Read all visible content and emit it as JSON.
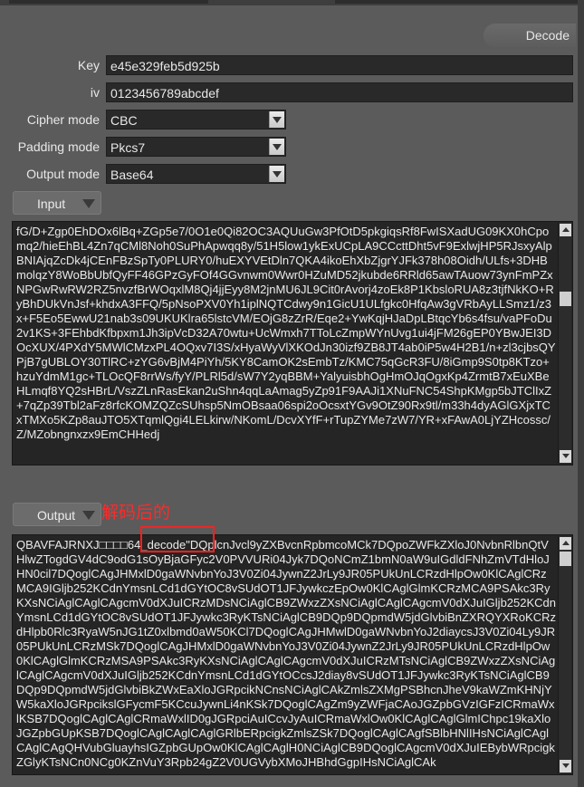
{
  "decode_button": "Decode",
  "key": {
    "label": "Key",
    "value": "e45e329feb5d925b"
  },
  "iv": {
    "label": "iv",
    "value": "0123456789abcdef"
  },
  "cipher_mode": {
    "label": "Cipher mode",
    "value": "CBC"
  },
  "padding_mode": {
    "label": "Padding mode",
    "value": "Pkcs7"
  },
  "output_mode": {
    "label": "Output mode",
    "value": "Base64"
  },
  "input_toggle": "Input",
  "input_text": "fG/D+Zgp0EhDOx6lBq+ZGp5e7/0O1e0Qi82OC3AQUuGw3PfOtD5pkgiqsRf8FwISXadUG09KX0hCpomq2/hieEhBL4Zn7qCMl8Noh0SuPhApwqq8y/51H5low1ykExUCpLA9CCcttDht5vF9ExlwjHP5RJsxyAlpBNIAjqZcDk4jCEnFBzSpTy0PLURY0/huEXYVEtDln7QKA4ikoEhXbZjgrYJFk378h08Oidh/ULfs+3DHBmolqzY8WoBbUbfQyFF46GPzGyFOf4GGvnwm0Wwr0HZuMD52jkubde6RRld65awTAuow73ynFmPZxNPGwRwRW2RZ5nvzfBrWOqxlM8Qj4jjEyy8M2jnMU6JL9Cit0rAvorj4zoEk8P1KbsloRUA8z3tjfNkKO+RyBhDUkVnJsf+khdxA3FFQ/5pNsoPXV0Yh1iplNQTCdwy9n1GicU1ULfgkc0HfqAw3gVRbAyLLSmz1/z3x+F5Eo5EwwU21nab3s09UKUKlra65lstcVM/EOjG8zZrR/Eqe2+YwKqjHJaDpLBtqcYb6s4fsu/vaPFoDu2v1KS+3FEhbdKfbpxm1Jh3ipVcD32A70wtu+UcWmxh7TToLcZmpWYnUvg1ui4jFM26gEP0YBwJEI3DOcXUX/4PXdY5MWlCMzxPL4OQxv7I3S/xHyaWyVlXKOdJn30izf9ZB8JT4ab0iP5w4H2B1/n+zl3cjbsQYPjB7gUBLOY30TlRC+zYG6vBjM4PiYh/5KY8CamOK2sEmbTz/KMC75qGcR3FU/8iGmp9S0tp8KTzo+hzuYdmM1gc+TLOcQF8rrWs/fyY/PLRl5d/sW7Y2yqBBM+YalyuisbhOgHmOJqOgxKp4ZrmtB7xEuXBeHLmqf8YQ2sHBrL/VszZLnRasEkan2uShn4qqLaAmag5yZp91F9AAJi1XNuFNC54ShpKMgp5bJTClIxZ+7qZp39Tbl2aFz8rfcKOMZQZcSUhsp5NmOBsaa06spi2oOcsxtYGv9OtZ90Rx9tl/m33h4dyAGlGXjxTCxTMXo5KZp8auJTO5XTqmlQgi4LELkirw/NKomL/DcvXYfF+rTupZYMe7zW7/YR+xFAwA0LjYZHcossc/Z/MZobngnxzx9EmCHHedj",
  "annotation_text": "解码后的",
  "output_toggle": "Output",
  "output_text": "QBAVFAJRNXJ□□□□64_decode\"DQplcnJvcl9yZXBvcnRpbmcoMCk7DQpoZWFkZXloJ0NvbnRlbnQtVHlwZTogdGV4dC9odG1sOyBjaGFyc2V0PVVURi04Jyk7DQoNCmZ1bmN0aW9uIGdldFNhZmVTdHloJHN0cil7DQoglCAgJHMxlD0gaWNvbnYoJ3V0Zi04JywnZ2JrLy9JR05PUkUnLCRzdHlpOw0KlCAglCRzMCA9IGljb252KCdnYmsnLCd1dGYtOC8vSUdOT1JFJywkczEpOw0KlCAglGlmKCRzMCA9PSAkc3RyKXsNCiAglCAglCAgcmV0dXJuICRzMDsNCiAglCB9ZWxzZXsNCiAglCAglCAgcmV0dXJuIGljb252KCdnYmsnLCd1dGYtOC8vSUdOT1JFJywkc3RyKTsNCiAglCB9DQp9DQpmdW5jdGlvbiBnZXRQYXRoKCRzdHlpb0Rlc3RyaW5nJG1tZ0xlbmd0aW50KCl7DQoglCAgJHMwlD0gaWNvbnYoJ2diaycsJ3V0Zi04Ly9JR05PUkUnLCRzMSk7DQoglCAgJHMxlD0gaWNvbnYoJ3V0Zi04JywnZ2JrLy9JR05PUkUnLCRzdHlpOw0KlCAglGlmKCRzMSA9PSAkc3RyKXsNCiAglCAglCAgcmV0dXJuICRzMTsNCiAglCB9ZWxzZXsNCiAglCAglCAgcmV0dXJuIGljb252KCdnYmsnLCd1dGYtOCcsJ2diay8vSUdOT1JFJywkc3RyKTsNCiAglCB9DQp9DQpmdW5jdGlvbiBkZWxEaXloJGRpcikNCnsNCiAglCAkZmlsZXMgPSBhcnJheV9kaWZmKHNjYW5kaXloJGRpcikslGFycmF5KCcuJywnLi4nKSk7DQoglCAgZm9yZWFjaCAoJGZpbGVzIGFzICRmaWxlKSB7DQoglCAglCAglCRmaWxlID0gJGRpciAuICcvJyAuICRmaWxlOw0KlCAglCAglGlmIChpc19kaXloJGZpbGUpKSB7DQoglCAglCAglCAglGRlbERpcigkZmlsZSk7DQoglCAglCAgfSBlbHNlIHsNCiAglCAglCAglCAgQHVubGluayhsIGZpbGUpOw0KlCAglCAglH0NCiAglCB9DQoglCAgcmV0dXJuIEBybWRpcigkZGlyKTsNCn0NCg0KZnVuY3Rpb24gZ2V0UGVybXMoJHBhdGgpIHsNCiAglCAk"
}
